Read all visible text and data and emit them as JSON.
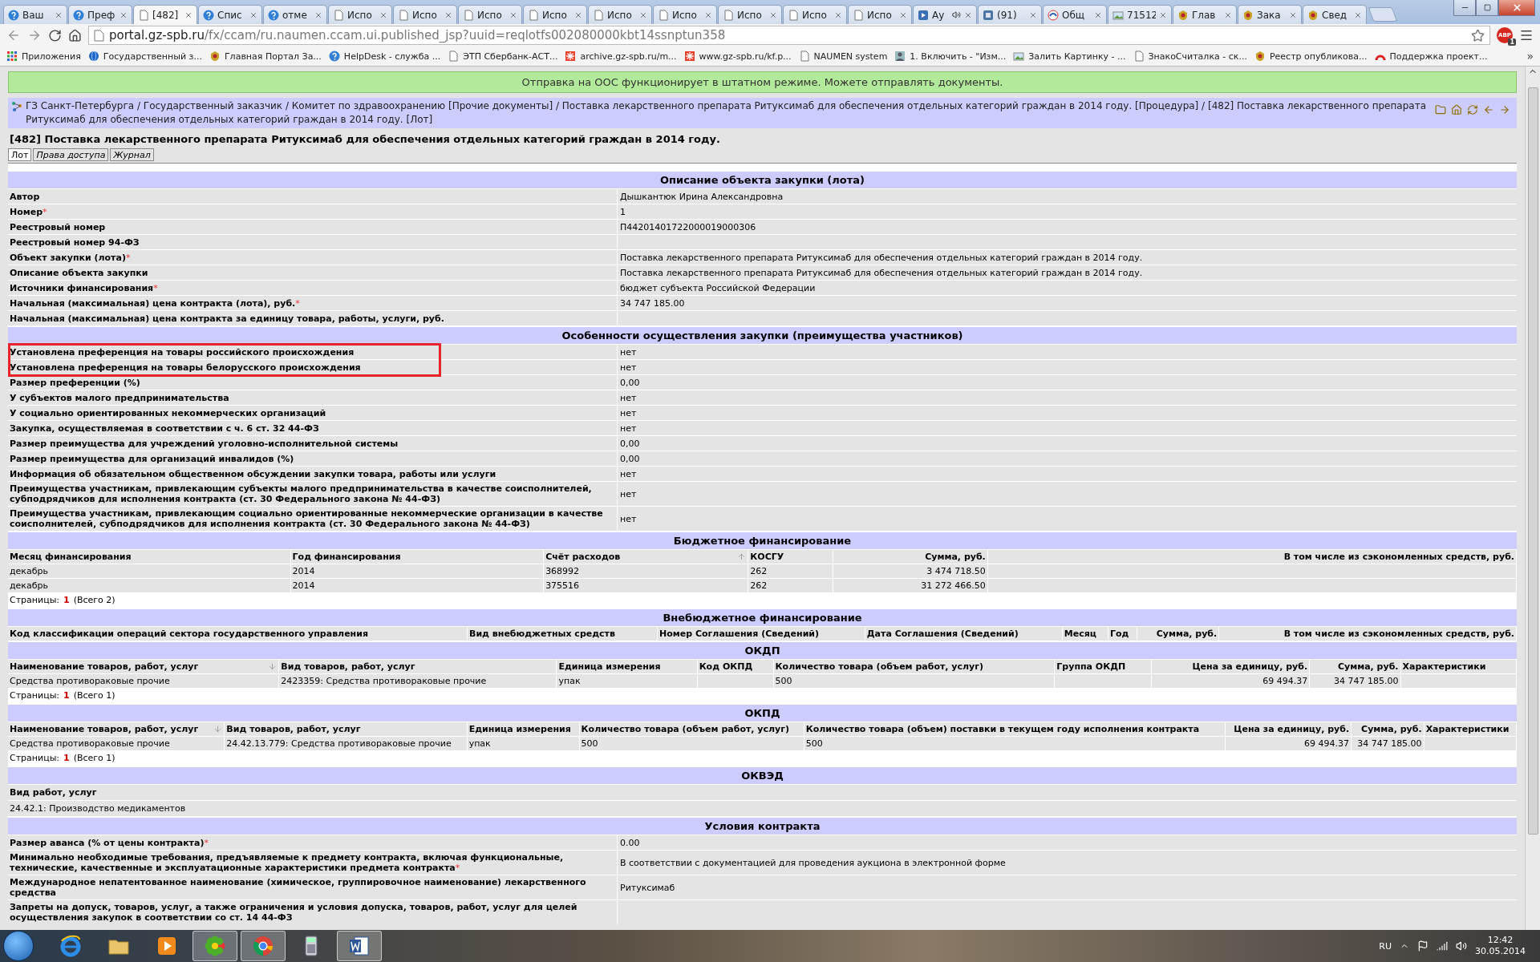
{
  "browser": {
    "tabs": [
      {
        "title": "Ваш",
        "kind": "help",
        "selected": false
      },
      {
        "title": "Преф",
        "kind": "help",
        "selected": false
      },
      {
        "title": "[482]",
        "kind": "page",
        "selected": true
      },
      {
        "title": "Спис",
        "kind": "help",
        "selected": false
      },
      {
        "title": "отме",
        "kind": "help",
        "selected": false
      },
      {
        "title": "Испо",
        "kind": "page",
        "selected": false
      },
      {
        "title": "Испо",
        "kind": "page",
        "selected": false
      },
      {
        "title": "Испо",
        "kind": "page",
        "selected": false
      },
      {
        "title": "Испо",
        "kind": "page",
        "selected": false
      },
      {
        "title": "Испо",
        "kind": "page",
        "selected": false
      },
      {
        "title": "Испо",
        "kind": "page",
        "selected": false
      },
      {
        "title": "Испо",
        "kind": "page",
        "selected": false
      },
      {
        "title": "Испо",
        "kind": "page",
        "selected": false
      },
      {
        "title": "Испо",
        "kind": "page",
        "selected": false
      },
      {
        "title": "Ау",
        "kind": "media",
        "selected": false
      },
      {
        "title": "(91)",
        "kind": "vk",
        "selected": false
      },
      {
        "title": "Общ",
        "kind": "mail",
        "selected": false
      },
      {
        "title": "71512",
        "kind": "image",
        "selected": false
      },
      {
        "title": "Глав",
        "kind": "emblem",
        "selected": false
      },
      {
        "title": "Зака",
        "kind": "emblem",
        "selected": false
      },
      {
        "title": "Свед",
        "kind": "emblem",
        "selected": false
      }
    ],
    "address_host": "portal.gz-spb.ru",
    "address_path": "/fx/ccam/ru.naumen.ccam.ui.published_jsp?uuid=reqlotfs002080000kbt14ssnptun358",
    "extension": {
      "label": "ABP",
      "count": "1"
    },
    "bookmarks": [
      {
        "title": "Приложения",
        "kind": "apps"
      },
      {
        "title": "Государственный з...",
        "kind": "globe"
      },
      {
        "title": "Главная Портал За...",
        "kind": "emblem"
      },
      {
        "title": "HelpDesk - служба ...",
        "kind": "help"
      },
      {
        "title": "ЭТП Сбербанк-АСТ...",
        "kind": "page"
      },
      {
        "title": "archive.gz-spb.ru/m...",
        "kind": "snow"
      },
      {
        "title": "www.gz-spb.ru/kf.p...",
        "kind": "snow"
      },
      {
        "title": "NAUMEN system",
        "kind": "page"
      },
      {
        "title": "1. Включить - \"Изм...",
        "kind": "avatar"
      },
      {
        "title": "Залить Картинку - ...",
        "kind": "image"
      },
      {
        "title": "ЗнакоСчиталка - ск...",
        "kind": "page"
      },
      {
        "title": "Реестр опубликова...",
        "kind": "emblem"
      },
      {
        "title": "Поддержка проект...",
        "kind": "arc"
      }
    ],
    "bookmarks_more": "»"
  },
  "banner": "Отправка на ООС функционирует в штатном режиме. Можете отправлять документы.",
  "breadcrumb": "ГЗ Санкт-Петербурга / Государственный заказчик / Комитет по здравоохранению [Прочие документы] / Поставка лекарственного препарата Ритуксимаб для обеспечения отдельных категорий граждан в 2014 году. [Процедура] / [482] Поставка лекарственного препарата Ритуксимаб для обеспечения отдельных категорий граждан в 2014 году. [Лот]",
  "title": "[482] Поставка лекарственного препарата Ритуксимаб для обеспечения отдельных категорий граждан в 2014 году.",
  "tabs": [
    {
      "label": "Лот",
      "selected": true
    },
    {
      "label": "Права доступа",
      "selected": false
    },
    {
      "label": "Журнал",
      "selected": false
    }
  ],
  "sections": [
    {
      "kind": "fields",
      "title": "Описание объекта закупки (лота)",
      "rows": [
        {
          "label": "Автор",
          "value": "Дышкантюк Ирина Александровна"
        },
        {
          "label": "Номер",
          "required": "*",
          "value": "1"
        },
        {
          "label": "Реестровый номер",
          "value": "П44201401722000019000306"
        },
        {
          "label": "Реестровый номер 94-ФЗ"
        },
        {
          "label": "Объект закупки (лота)",
          "required": "*",
          "value": "Поставка лекарственного препарата Ритуксимаб для обеспечения отдельных категорий граждан в 2014 году."
        },
        {
          "label": "Описание объекта закупки",
          "value": "Поставка лекарственного препарата Ритуксимаб для обеспечения отдельных категорий граждан в 2014 году."
        },
        {
          "label": "Источники финансирования",
          "required": "*",
          "value": "бюджет субъекта Российской Федерации"
        },
        {
          "label": "Начальная (максимальная) цена контракта (лота), руб.",
          "required": "*",
          "value": "34 747 185.00"
        },
        {
          "label": "Начальная (максимальная) цена контракта за единицу товара, работы, услуги, руб."
        }
      ]
    },
    {
      "kind": "fields",
      "title": "Особенности осуществления закупки (преимущества участников)",
      "rows": [
        {
          "label": "Установлена преференция на товары российского происхождения",
          "value": "нет",
          "marked": true
        },
        {
          "label": "Установлена преференция на товары белорусского происхождения",
          "value": "нет",
          "marked": true
        },
        {
          "label": "Размер преференции (%)",
          "value": "0,00",
          "marked": false
        },
        {
          "label": "У субъектов малого предпринимательства",
          "value": "нет",
          "marked": false
        },
        {
          "label": "У социально ориентированных некоммерческих организаций",
          "value": "нет",
          "marked": false
        },
        {
          "label": "Закупка, осуществляемая в соответствии с ч. 6 ст. 32 44-ФЗ",
          "value": "нет",
          "marked": false
        },
        {
          "label": "Размер преимущества для учреждений уголовно-исполнительной системы",
          "value": "0,00",
          "marked": false
        },
        {
          "label": "Размер преимущества для организаций инвалидов (%)",
          "value": "0,00",
          "marked": false
        },
        {
          "label": "Информация об обязательном общественном обсуждении закупки товара, работы или услуги",
          "value": "нет",
          "marked": false
        },
        {
          "label": "Преимущества участникам, привлекающим субъекты малого предпринимательства в качестве соисполнителей, субподрядчиков для исполнения контракта (ст. 30 Федерального закона № 44-ФЗ)",
          "value": "нет",
          "marked": false
        },
        {
          "label": "Преимущества участникам, привлекающим социально ориентированные некоммерческие организации в качестве соисполнителей, субподрядчиков для исполнения контракта (ст. 30 Федерального закона № 44-ФЗ)",
          "value": "нет",
          "marked": false
        }
      ]
    },
    {
      "kind": "table",
      "title": "Бюджетное финансирование",
      "columns": [
        {
          "label": "Месяц финансирования"
        },
        {
          "label": "Год финансирования"
        },
        {
          "label": "Счёт расходов",
          "sorted": true,
          "ascending": true
        },
        {
          "label": "КОСГУ"
        },
        {
          "label": "Сумма, руб.",
          "numeric": true
        },
        {
          "label": "В том числе из сэкономленных средств, руб.",
          "numeric": true
        }
      ],
      "rows": [
        [
          "декабрь",
          "2014",
          "368992",
          "262",
          "3 474 718.50",
          ""
        ],
        [
          "декабрь",
          "2014",
          "375516",
          "262",
          "31 272 466.50",
          ""
        ]
      ],
      "pager": {
        "label": "Страницы:",
        "current": "1",
        "total": "(Всего 2)"
      }
    },
    {
      "kind": "table",
      "title": "Внебюджетное финансирование",
      "columns": [
        {
          "label": "Код классификации операций сектора государственного управления"
        },
        {
          "label": "Вид внебюджетных средств"
        },
        {
          "label": "Номер Соглашения (Сведений)"
        },
        {
          "label": "Дата Соглашения (Сведений)"
        },
        {
          "label": "Месяц"
        },
        {
          "label": "Год"
        },
        {
          "label": "Сумма, руб.",
          "numeric": true
        },
        {
          "label": "В том числе из сэкономленных средств, руб.",
          "numeric": true
        }
      ]
    },
    {
      "kind": "table",
      "title": "ОКДП",
      "columns": [
        {
          "label": "Наименование товаров, работ, услуг",
          "sorted": true,
          "ascending": false
        },
        {
          "label": "Вид товаров, работ, услуг"
        },
        {
          "label": "Единица измерения"
        },
        {
          "label": "Код ОКПД"
        },
        {
          "label": "Количество товара (объем работ, услуг)"
        },
        {
          "label": "Группа ОКДП"
        },
        {
          "label": "Цена за единицу, руб.",
          "numeric": true
        },
        {
          "label": "Сумма, руб.",
          "numeric": true
        },
        {
          "label": "Характеристики"
        }
      ],
      "rows": [
        [
          "Средства противораковые прочие",
          "2423359: Средства противораковые прочие",
          "упак",
          "",
          "500",
          "",
          "69 494.37",
          "34 747 185.00",
          ""
        ]
      ],
      "pager": {
        "label": "Страницы:",
        "current": "1",
        "total": "(Всего 1)"
      }
    },
    {
      "kind": "table",
      "title": "ОКПД",
      "columns": [
        {
          "label": "Наименование товаров, работ, услуг",
          "sorted": true,
          "ascending": false
        },
        {
          "label": "Вид товаров, работ, услуг"
        },
        {
          "label": "Единица измерения"
        },
        {
          "label": "Количество товара (объем работ, услуг)"
        },
        {
          "label": "Количество товара (объем) поставки в текущем году исполнения контракта"
        },
        {
          "label": "Цена за единицу, руб.",
          "numeric": true
        },
        {
          "label": "Сумма, руб.",
          "numeric": true
        },
        {
          "label": "Характеристики"
        }
      ],
      "rows": [
        [
          "Средства противораковые прочие",
          "24.42.13.779: Средства противораковые прочие",
          "упак",
          "500",
          "500",
          "69 494.37",
          "34 747 185.00",
          ""
        ]
      ],
      "pager": {
        "label": "Страницы:",
        "current": "1",
        "total": "(Всего 1)"
      }
    },
    {
      "kind": "list",
      "title": "ОКВЭД",
      "label": "Вид работ, услуг",
      "items": [
        "24.42.1: Производство медикаментов"
      ]
    },
    {
      "kind": "fields",
      "title": "Условия контракта",
      "rows": [
        {
          "label": "Размер аванса (% от цены контракта)",
          "required": "*",
          "value": "0.00"
        },
        {
          "label": "Минимально необходимые требования, предъявляемые к предмету контракта, включая функциональные, технические, качественные и эксплуатационные характеристики предмета контракта",
          "required": "*",
          "value": "В соответствии с документацией для проведения аукциона в электронной форме"
        },
        {
          "label": "Международное непатентованное наименование (химическое, группировочное наименование) лекарственного средства",
          "value": "Ритуксимаб"
        },
        {
          "label": "Запреты на допуск, товаров, услуг, а также ограничения и условия допуска, товаров, работ, услуг для целей осуществления закупок в соответствии со ст. 14 44-ФЗ"
        }
      ]
    }
  ],
  "taskbar": {
    "apps": [
      {
        "kind": "ie",
        "active": false
      },
      {
        "kind": "folder",
        "active": false
      },
      {
        "kind": "media",
        "active": false
      },
      {
        "kind": "icq",
        "active": true
      },
      {
        "kind": "chrome",
        "active": true
      },
      {
        "kind": "calc",
        "active": false
      },
      {
        "kind": "word",
        "active": true
      }
    ],
    "language": "RU",
    "time": "12:42",
    "date": "30.05.2014"
  }
}
